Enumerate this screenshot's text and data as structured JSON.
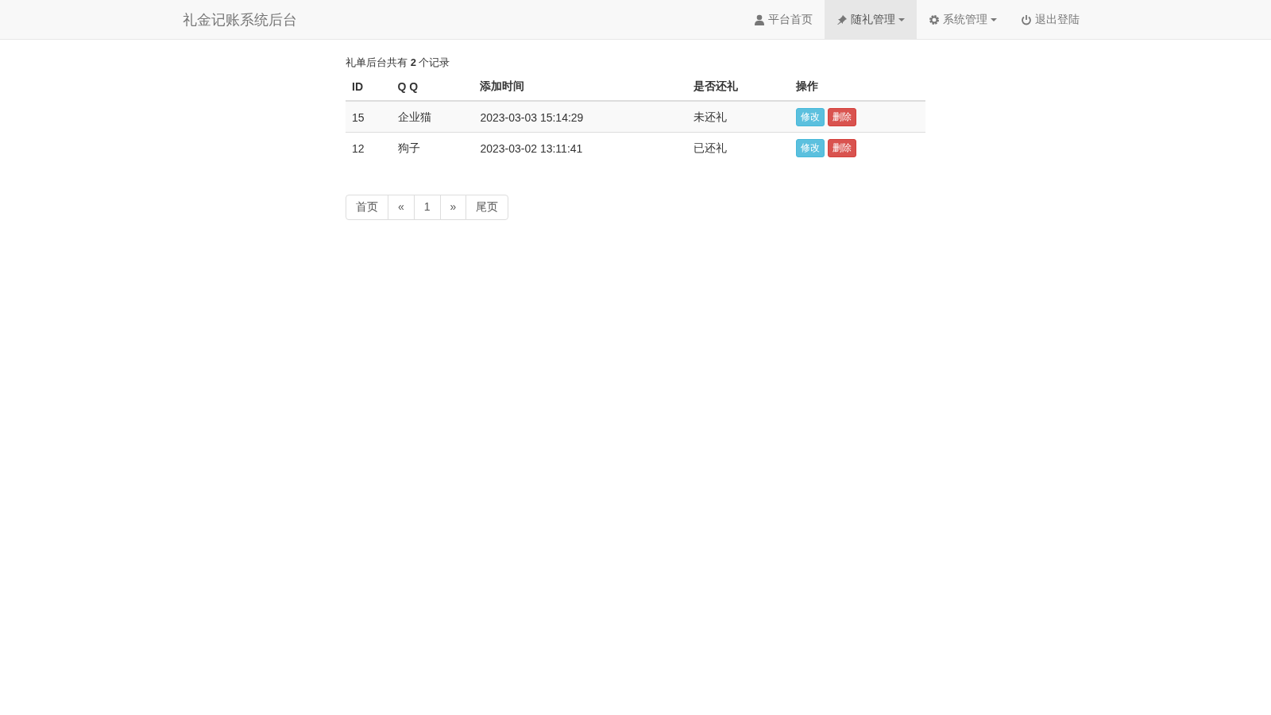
{
  "navbar": {
    "brand": "礼金记账系统后台",
    "items": [
      {
        "label": "平台首页",
        "kind": "user",
        "dropdown": false,
        "selected": false
      },
      {
        "label": "随礼管理",
        "kind": "pin",
        "dropdown": true,
        "selected": true
      },
      {
        "label": "系统管理",
        "kind": "gear",
        "dropdown": true,
        "selected": false
      },
      {
        "label": "退出登陆",
        "kind": "power",
        "dropdown": false,
        "selected": false
      }
    ]
  },
  "summary": "礼单后台共有 **2** 个记录",
  "table": {
    "columns": [
      "ID",
      "Q Q",
      "添加时间",
      "是否还礼",
      "操作"
    ],
    "rows": [
      {
        "id": "15",
        "qq": "企业猫",
        "time": "2023-03-03 15:14:29",
        "status": "未还礼",
        "actions": [
          {
            "label": "修改",
            "kind": "info"
          },
          {
            "label": "删除",
            "kind": "danger"
          }
        ]
      },
      {
        "id": "12",
        "qq": "狗子",
        "time": "2023-03-02 13:11:41",
        "status": "已还礼",
        "actions": [
          {
            "label": "修改",
            "kind": "info"
          },
          {
            "label": "删除",
            "kind": "danger"
          }
        ]
      }
    ]
  },
  "pagination": [
    "首页",
    "«",
    "1",
    "»",
    "尾页"
  ]
}
